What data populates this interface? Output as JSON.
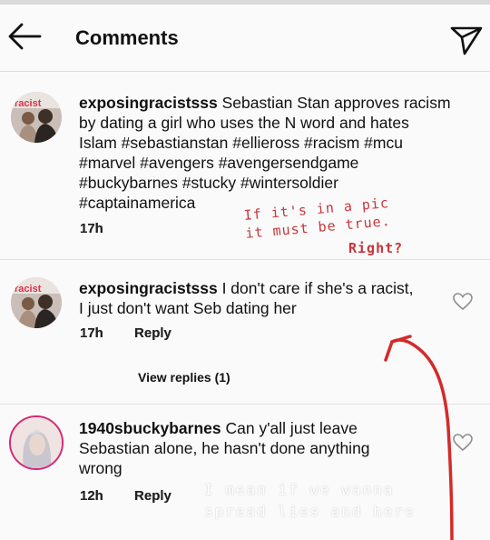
{
  "header": {
    "title": "Comments"
  },
  "comments": [
    {
      "username": "exposingracistsss",
      "text": " Sebastian Stan approves racism by dating a girl who uses the N word and hates Islam #sebastianstan #ellieross #racism #mcu #marvel #avengers #avengersendgame #buckybarnes #stucky #wintersoldier #captainamerica",
      "time": "17h"
    },
    {
      "username": "exposingracistsss",
      "text": " I don't care if she's a racist, I just don't want Seb dating her",
      "time": "17h",
      "reply_label": "Reply",
      "view_replies": "View replies (1)"
    },
    {
      "username": "1940sbuckybarnes",
      "text": " Can y'all just leave Sebastian alone, he hasn't done anything wrong",
      "time": "12h",
      "reply_label": "Reply"
    }
  ],
  "annotations": {
    "note1_line1": "If it's in a pic",
    "note1_line2": "it must be true.",
    "note2": "Right?",
    "note3": "I mean if we wanna spread lies and here"
  },
  "colors": {
    "annotation_red": "#c8363a",
    "divider": "#e0e0e0",
    "background": "#fafafa"
  },
  "icons": [
    "back-arrow-icon",
    "send-icon",
    "heart-icon",
    "red-arrow-drawing"
  ]
}
